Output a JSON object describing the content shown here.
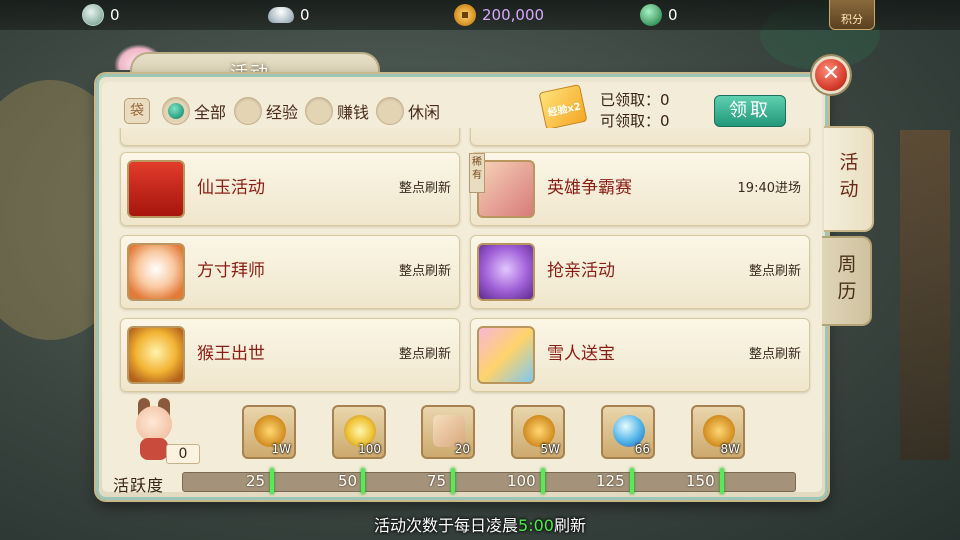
{
  "resources": [
    {
      "icon": "silver-badge-icon",
      "value": "0"
    },
    {
      "icon": "silver-ingot-icon",
      "value": "0"
    },
    {
      "icon": "copper-coin-icon",
      "value": "200,000"
    },
    {
      "icon": "jade-icon",
      "value": "0"
    }
  ],
  "top_button": {
    "label": "积分"
  },
  "panel": {
    "title": "活动",
    "close_icon": "close-icon",
    "filters": [
      {
        "label": "全部",
        "selected": true
      },
      {
        "label": "经验",
        "selected": false
      },
      {
        "label": "赚钱",
        "selected": false
      },
      {
        "label": "休闲",
        "selected": false
      }
    ],
    "ticket_label": "经验x2",
    "claimed_label": "已领取：0",
    "claimable_label": "可领取：0",
    "claim_button": "领取"
  },
  "activities": [
    {
      "name": "仙玉活动",
      "status": "整点刷新",
      "icon": "red-envelope-icon",
      "rare": false
    },
    {
      "name": "英雄争霸赛",
      "status": "19:40进场",
      "icon": "all-trophy-icon",
      "rare": true,
      "rare_label": "稀有"
    },
    {
      "name": "方寸拜师",
      "status": "整点刷新",
      "icon": "cloud-emblem-icon",
      "rare": false
    },
    {
      "name": "抢亲活动",
      "status": "整点刷新",
      "icon": "bell-icon",
      "rare": false
    },
    {
      "name": "猴王出世",
      "status": "整点刷新",
      "icon": "monkey-king-icon",
      "rare": false
    },
    {
      "name": "雪人送宝",
      "status": "整点刷新",
      "icon": "gift-box-icon",
      "rare": false
    }
  ],
  "side_tabs": [
    {
      "label": "活动",
      "active": true
    },
    {
      "label": "周历",
      "active": false
    }
  ],
  "activity": {
    "label": "活跃度",
    "score": "0",
    "milestones": [
      "25",
      "50",
      "75",
      "100",
      "125",
      "150"
    ]
  },
  "rewards": [
    {
      "icon": "copper-coin-icon",
      "count": "1W"
    },
    {
      "icon": "golden-flower-icon",
      "count": "100"
    },
    {
      "icon": "scroll-icon",
      "count": "20"
    },
    {
      "icon": "copper-coin-icon",
      "count": "5W"
    },
    {
      "icon": "spirit-orb-icon",
      "count": "66"
    },
    {
      "icon": "copper-coin-icon",
      "count": "8W"
    }
  ],
  "footer": {
    "before": "活动次数于每日凌晨",
    "time": "5:00",
    "after": "刷新"
  }
}
